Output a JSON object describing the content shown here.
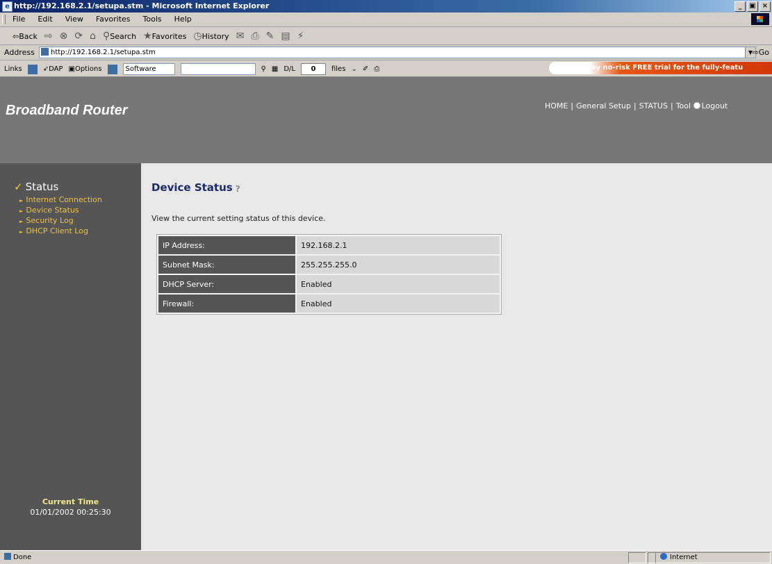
{
  "window": {
    "title": "http://192.168.2.1/setupa.stm - Microsoft Internet Explorer",
    "buttons": {
      "minimize": "_",
      "maximize": "▣",
      "close": "×"
    }
  },
  "menu": [
    "File",
    "Edit",
    "View",
    "Favorites",
    "Tools",
    "Help"
  ],
  "toolbar": {
    "back": "⇦Back",
    "forward": "⇨",
    "search": "Search",
    "favorites": "Favorites",
    "history": "History"
  },
  "address": {
    "label": "Address",
    "url": "http://192.168.2.1/setupa.stm",
    "go": "Go"
  },
  "links": {
    "label": "Links",
    "dap": "DAP",
    "options": "Options",
    "software": "Software",
    "dl_label": "D/L",
    "dl_value": "0",
    "files": "files"
  },
  "promo": "14-day no-risk FREE trial for the fully-featu",
  "router": {
    "brand": "Broadband Router",
    "nav": {
      "home": "HOME",
      "general": "General Setup",
      "status": "STATUS",
      "tool": "Tool",
      "logout": "Logout"
    }
  },
  "sidebar": {
    "section": "Status",
    "items": [
      "Internet Connection",
      "Device Status",
      "Security Log",
      "DHCP Client Log"
    ],
    "current_time_label": "Current Time",
    "current_time_value": "01/01/2002 00:25:30"
  },
  "main": {
    "title": "Device Status",
    "description": "View the current setting status of this device.",
    "rows": [
      {
        "label": "IP Address:",
        "value": "192.168.2.1"
      },
      {
        "label": "Subnet Mask:",
        "value": "255.255.255.0"
      },
      {
        "label": "DHCP Server:",
        "value": "Enabled"
      },
      {
        "label": "Firewall:",
        "value": "Enabled"
      }
    ]
  },
  "statusbar": {
    "text": "Done",
    "zone": "Internet"
  }
}
